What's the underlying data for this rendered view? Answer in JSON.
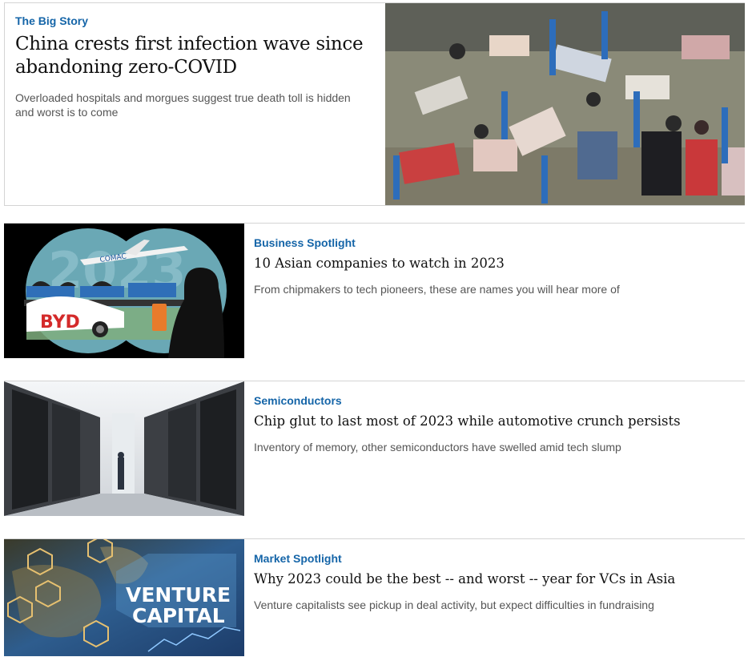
{
  "big_story": {
    "kicker": "The Big Story",
    "headline": "China crests first infection wave since abandoning zero-COVID",
    "summary": "Overloaded hospitals and morgues suggest true death toll is hidden and worst is to come"
  },
  "articles": [
    {
      "kicker": "Business Spotlight",
      "headline": "10 Asian companies to watch in 2023",
      "summary": "From chipmakers to tech pioneers, these are names you will hear more of",
      "image_text": {
        "year": "2023",
        "airline": "COMAC",
        "car": "BYD"
      }
    },
    {
      "kicker": "Semiconductors",
      "headline": "Chip glut to last most of 2023 while automotive crunch persists",
      "summary": "Inventory of memory, other semiconductors have swelled amid tech slump"
    },
    {
      "kicker": "Market Spotlight",
      "headline": "Why 2023 could be the best -- and worst -- year for VCs in Asia",
      "summary": "Venture capitalists see pickup in deal activity, but expect difficulties in fundraising",
      "image_text": {
        "line1": "VENTURE",
        "line2": "CAPITAL"
      }
    }
  ],
  "colors": {
    "kicker": "#1565a8",
    "headline": "#111111",
    "summary": "#555555",
    "divider": "#d4d4d4"
  }
}
